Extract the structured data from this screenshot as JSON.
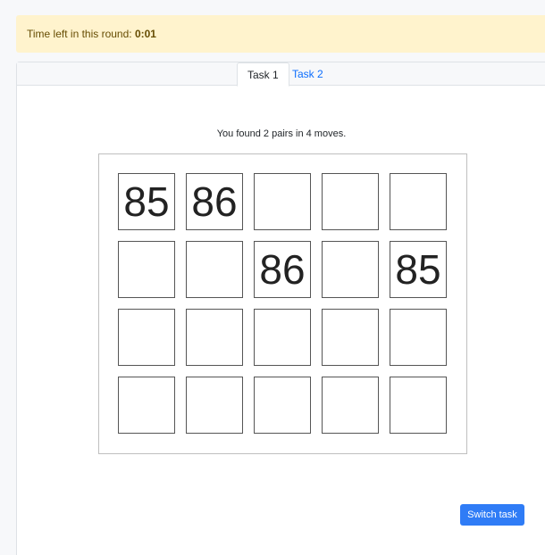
{
  "timer": {
    "label": "Time left in this round:",
    "value": "0:01"
  },
  "tabs": [
    {
      "label": "Task 1",
      "active": true
    },
    {
      "label": "Task 2",
      "active": false
    }
  ],
  "status_text": "You found 2 pairs in 4 moves.",
  "board": {
    "rows": 4,
    "cols": 5,
    "cells": [
      "85",
      "86",
      "",
      "",
      "",
      "",
      "",
      "86",
      "",
      "85",
      "",
      "",
      "",
      "",
      "",
      "",
      "",
      "",
      "",
      ""
    ]
  },
  "switch_button": {
    "label": "Switch task"
  },
  "colors": {
    "accent": "#2f7cf6",
    "alert_bg": "#fff3cd",
    "alert_text": "#664d03"
  }
}
